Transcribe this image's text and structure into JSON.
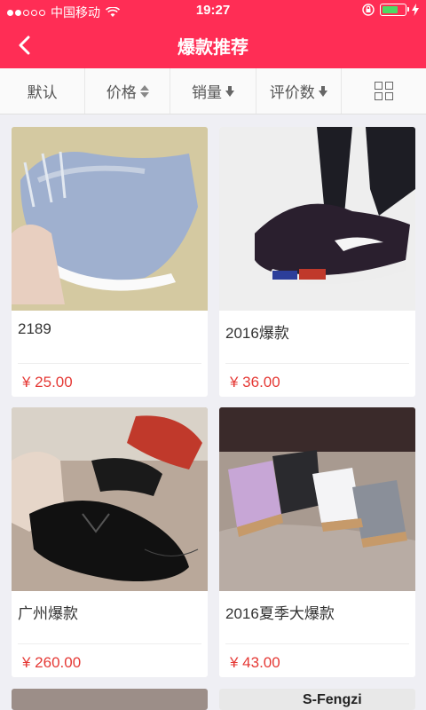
{
  "status_bar": {
    "carrier": "中国移动",
    "time": "19:27",
    "signal_dots_filled": 2,
    "signal_dots_total": 5,
    "battery_level": 0.6
  },
  "nav": {
    "title": "爆款推荐",
    "back_icon": "chevron-left-icon",
    "color": "#ff2d55"
  },
  "sort_bar": {
    "items": [
      {
        "label": "默认"
      },
      {
        "label": "价格",
        "icon": "sort-both-icon"
      },
      {
        "label": "销量",
        "icon": "sort-down-icon"
      },
      {
        "label": "评价数",
        "icon": "sort-down-icon"
      }
    ],
    "layout_icon": "grid-layout-icon"
  },
  "products": [
    {
      "name": "2189",
      "price": "¥ 25.00",
      "image": "denim-slipper"
    },
    {
      "name": "2016爆款",
      "price": "¥ 36.00",
      "image": "black-sneaker"
    },
    {
      "name": "广州爆款",
      "price": "¥ 260.00",
      "image": "patent-loafer"
    },
    {
      "name": "2016夏季大爆款",
      "price": "¥ 43.00",
      "image": "metallic-slides"
    }
  ],
  "partial_brand_text": "S-Fengzi"
}
